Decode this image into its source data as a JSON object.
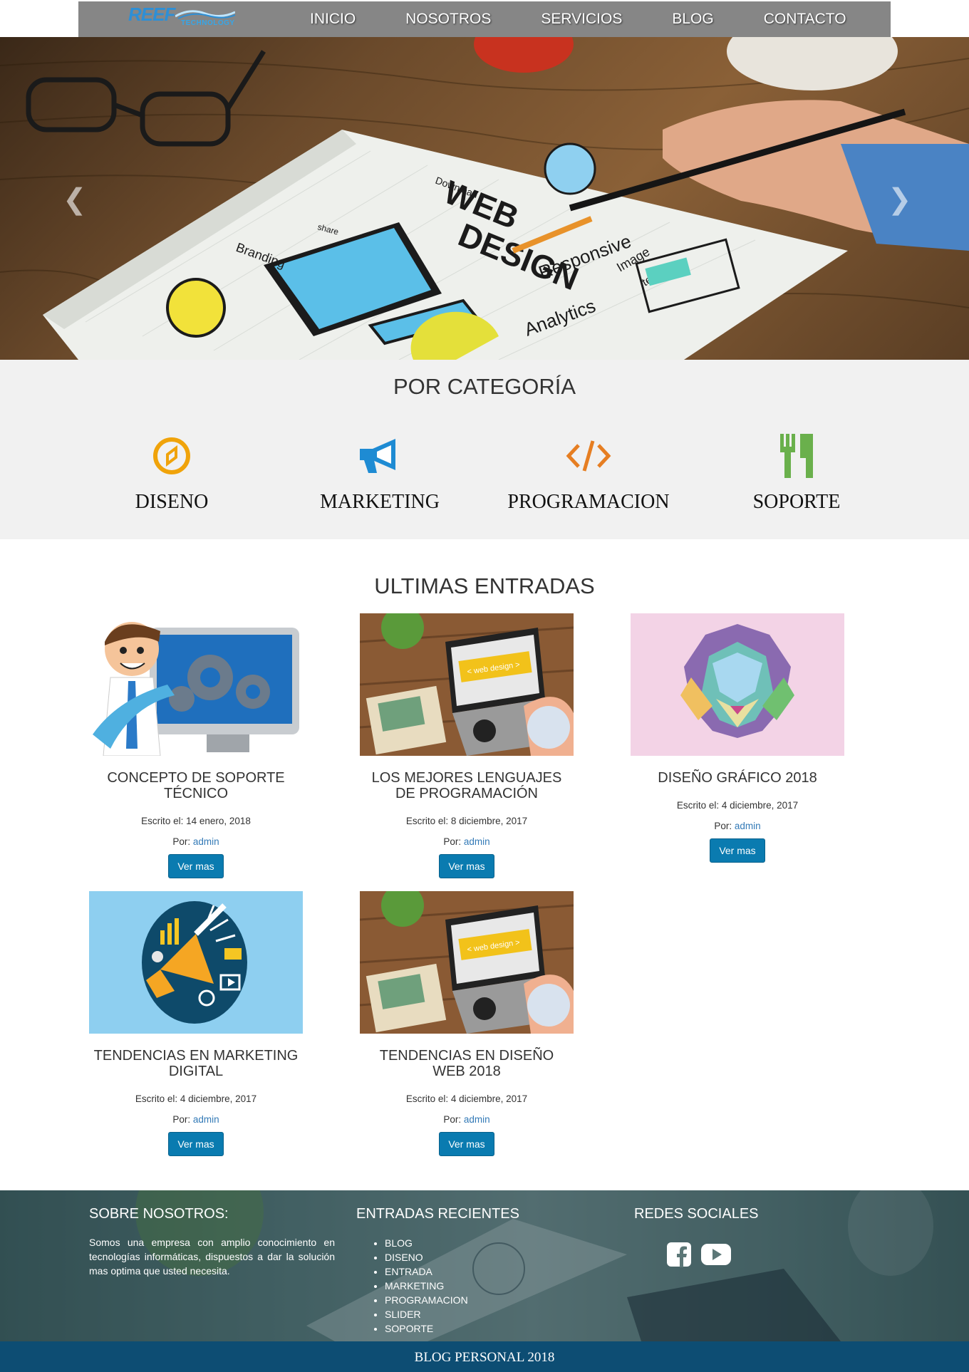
{
  "nav": {
    "logo_main": "REEF",
    "logo_sub": "TECHNOLOGY",
    "items": [
      {
        "label": "INICIO"
      },
      {
        "label": "NOSOTROS"
      },
      {
        "label": "SERVICIOS"
      },
      {
        "label": "BLOG"
      },
      {
        "label": "CONTACTO"
      }
    ]
  },
  "hero": {
    "prev_icon": "chevron-left-icon",
    "next_icon": "chevron-right-icon",
    "notebook_words": [
      "WEB",
      "DESIGN",
      "Responsive",
      "Analytics",
      "Branding",
      "Download",
      "Image",
      "text",
      "share"
    ]
  },
  "categories": {
    "title": "POR CATEGORÍA",
    "items": [
      {
        "label": "DISENO",
        "icon": "compass-icon",
        "color": "#f0a30a"
      },
      {
        "label": "MARKETING",
        "icon": "megaphone-icon",
        "color": "#1e8bd3"
      },
      {
        "label": "PROGRAMACION",
        "icon": "code-icon",
        "color": "#e67e22"
      },
      {
        "label": "SOPORTE",
        "icon": "cutlery-icon",
        "color": "#6ab04c"
      }
    ]
  },
  "posts": {
    "title": "ULTIMAS ENTRADAS",
    "items": [
      {
        "title": "CONCEPTO DE SOPORTE TÉCNICO",
        "date": "Escrito el: 14 enero, 2018",
        "author_prefix": "Por:",
        "author": "admin",
        "button": "Ver mas"
      },
      {
        "title": "LOS MEJORES LENGUAJES DE PROGRAMACIÓN",
        "date": "Escrito el: 8 diciembre, 2017",
        "author_prefix": "Por:",
        "author": "admin",
        "button": "Ver mas"
      },
      {
        "title": "DISEÑO GRÁFICO 2018",
        "date": "Escrito el: 4 diciembre, 2017",
        "author_prefix": "Por:",
        "author": "admin",
        "button": "Ver mas"
      },
      {
        "title": "TENDENCIAS EN MARKETING DIGITAL",
        "date": "Escrito el: 4 diciembre, 2017",
        "author_prefix": "Por:",
        "author": "admin",
        "button": "Ver mas"
      },
      {
        "title": "TENDENCIAS EN DISEÑO WEB 2018",
        "date": "Escrito el: 4 diciembre, 2017",
        "author_prefix": "Por:",
        "author": "admin",
        "button": "Ver mas"
      }
    ],
    "image_text": "< web design >"
  },
  "footer": {
    "about_title": "SOBRE NOSOTROS:",
    "about_text": "Somos una empresa con amplio conocimiento en tecnologías informáticas, dispuestos a dar la solución mas optima que usted necesita.",
    "recent_title": "ENTRADAS RECIENTES",
    "recent": [
      "BLOG",
      "DISENO",
      "ENTRADA",
      "MARKETING",
      "PROGRAMACION",
      "SLIDER",
      "SOPORTE"
    ],
    "social_title": "REDES SOCIALES",
    "social_icons": [
      "facebook-icon",
      "youtube-icon"
    ],
    "copyright": "BLOG PERSONAL 2018"
  },
  "colors": {
    "nav_bg": "#868686",
    "category_bg": "#f1f1f1",
    "button_bg": "#0a7bb0",
    "copyright_bg": "#0d4d73",
    "link": "#337ab7"
  }
}
